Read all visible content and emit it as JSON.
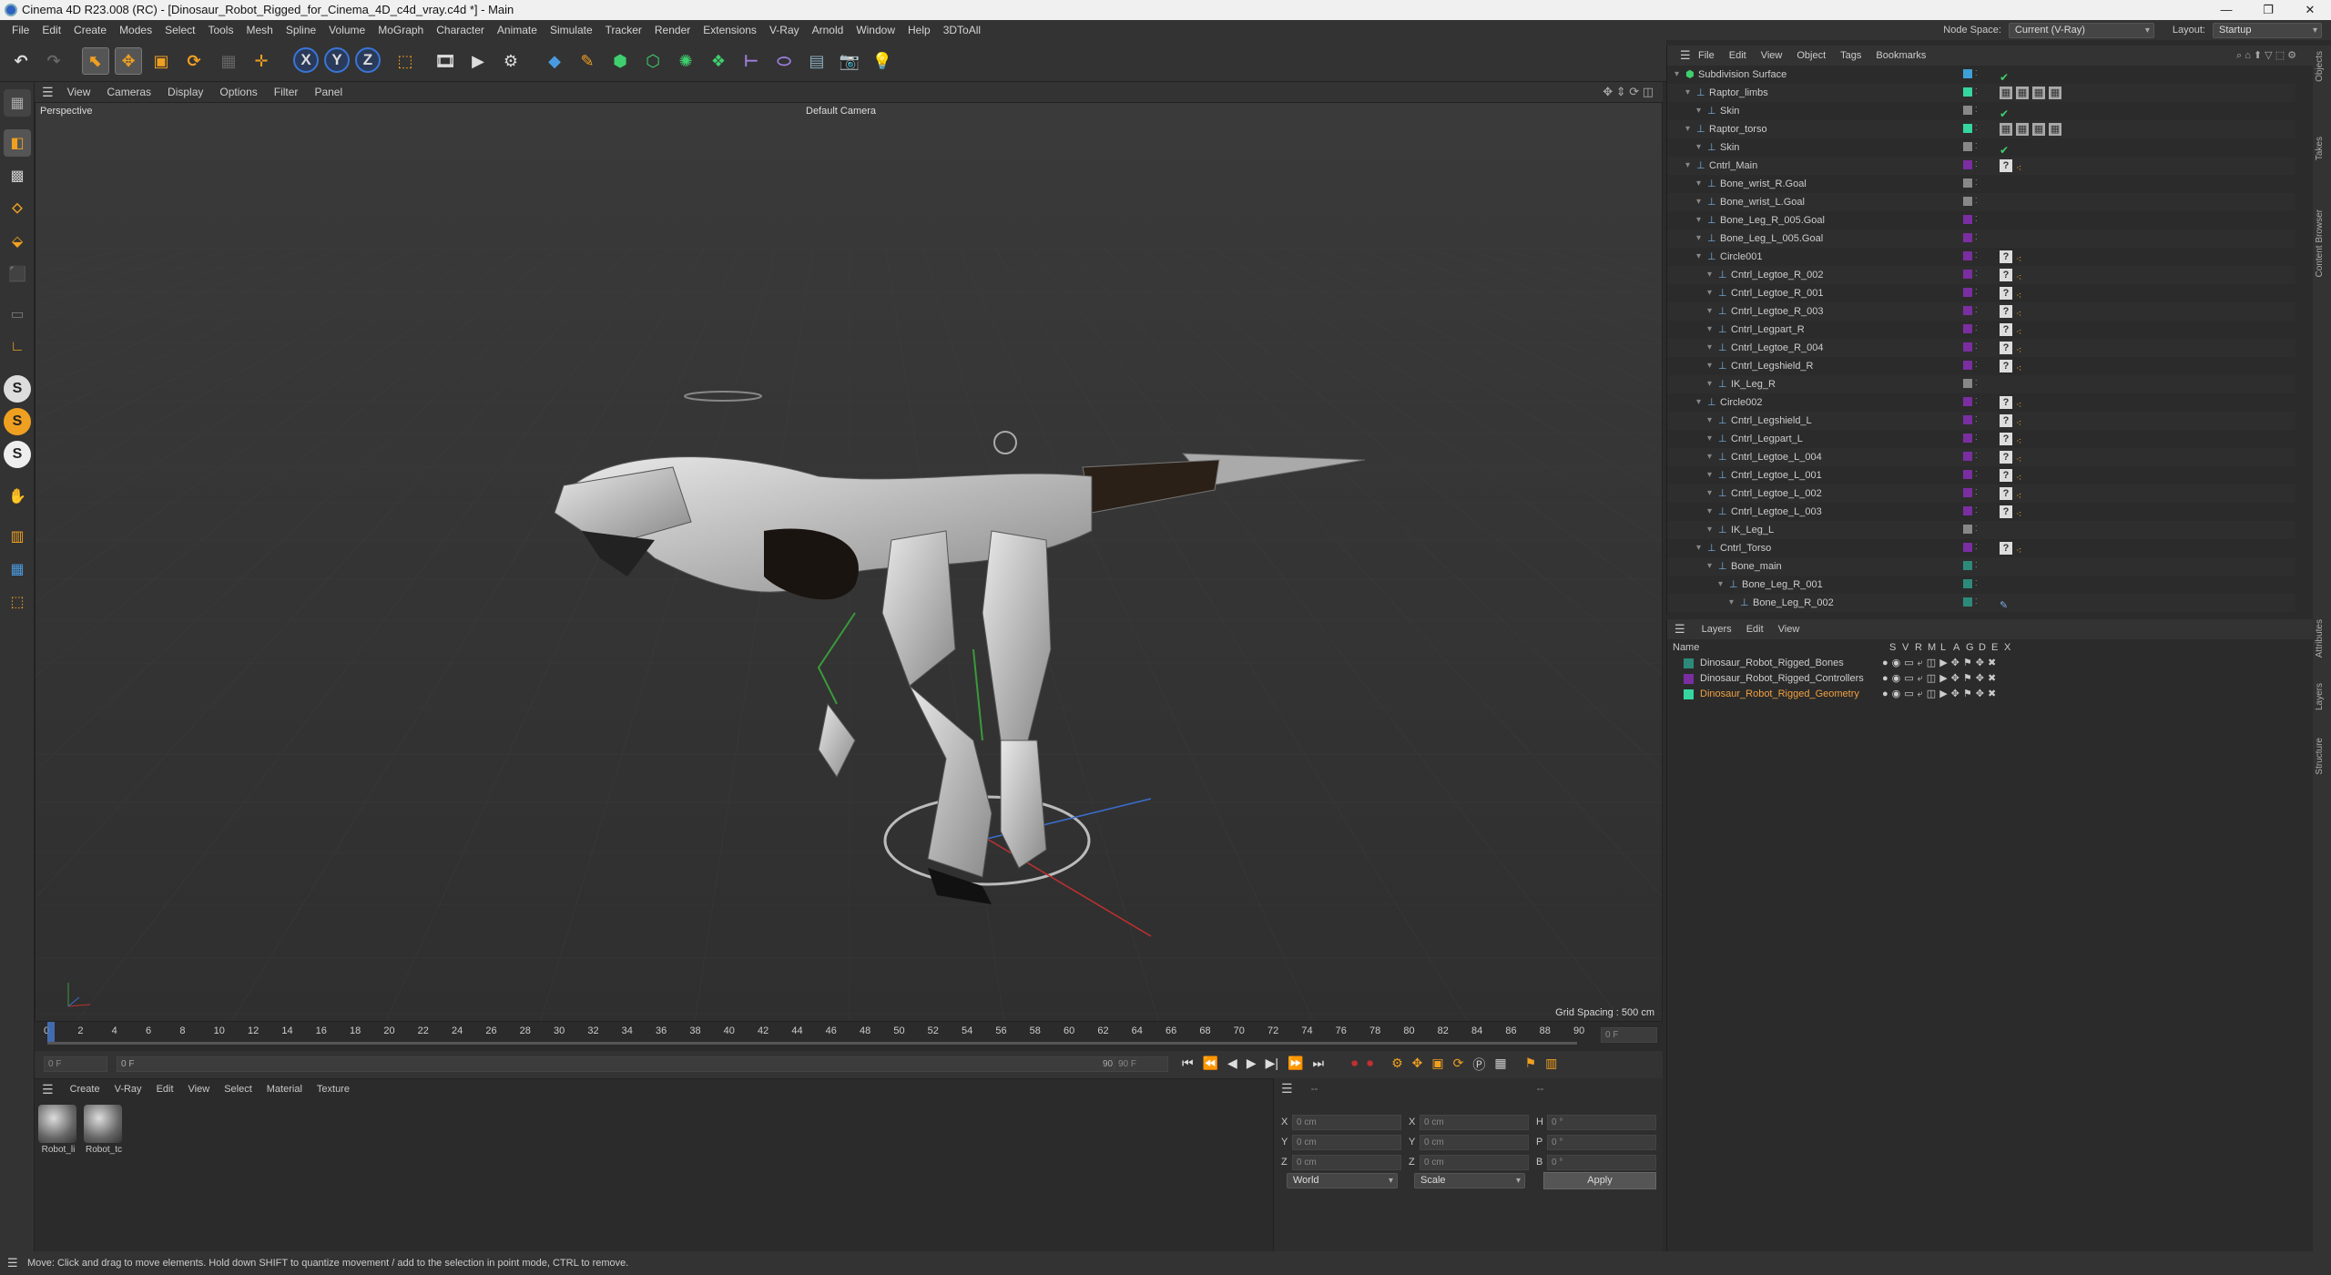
{
  "window": {
    "title": "Cinema 4D R23.008 (RC) - [Dinosaur_Robot_Rigged_for_Cinema_4D_c4d_vray.c4d *] - Main",
    "min": "—",
    "max": "❐",
    "close": "✕"
  },
  "menu": [
    "File",
    "Edit",
    "Create",
    "Modes",
    "Select",
    "Tools",
    "Mesh",
    "Spline",
    "Volume",
    "MoGraph",
    "Character",
    "Animate",
    "Simulate",
    "Tracker",
    "Render",
    "Extensions",
    "V-Ray",
    "Arnold",
    "Window",
    "Help",
    "3DToAll"
  ],
  "nodespace": {
    "label": "Node Space:",
    "value": "Current (V-Ray)"
  },
  "layout": {
    "label": "Layout:",
    "value": "Startup"
  },
  "toolbar": {
    "x": "X",
    "y": "Y",
    "z": "Z"
  },
  "viewport": {
    "menus": [
      "View",
      "Cameras",
      "Display",
      "Options",
      "Filter",
      "Panel"
    ],
    "name": "Perspective",
    "camera": "Default Camera",
    "grid": "Grid Spacing : 500 cm"
  },
  "timeline": {
    "ticks": [
      "0",
      "2",
      "4",
      "6",
      "8",
      "10",
      "12",
      "14",
      "16",
      "18",
      "20",
      "22",
      "24",
      "26",
      "28",
      "30",
      "32",
      "34",
      "36",
      "38",
      "40",
      "42",
      "44",
      "46",
      "48",
      "50",
      "52",
      "54",
      "56",
      "58",
      "60",
      "62",
      "64",
      "66",
      "68",
      "70",
      "72",
      "74",
      "76",
      "78",
      "80",
      "82",
      "84",
      "86",
      "88",
      "90"
    ],
    "frame_end": "0 F"
  },
  "playback": {
    "start": "0 F",
    "current": "0 F",
    "end": "90 F",
    "end2": "90 F"
  },
  "materials": {
    "menus": [
      "Create",
      "V-Ray",
      "Edit",
      "View",
      "Select",
      "Material",
      "Texture"
    ],
    "items": [
      "Robot_li",
      "Robot_tc"
    ]
  },
  "coords": {
    "header": "--",
    "sep": "--",
    "rows": [
      {
        "a": "X",
        "av": "0 cm",
        "b": "X",
        "bv": "0 cm",
        "c": "H",
        "cv": "0 °"
      },
      {
        "a": "Y",
        "av": "0 cm",
        "b": "Y",
        "bv": "0 cm",
        "c": "P",
        "cv": "0 °"
      },
      {
        "a": "Z",
        "av": "0 cm",
        "b": "Z",
        "bv": "0 cm",
        "c": "B",
        "cv": "0 °"
      }
    ],
    "mode": "World",
    "scale": "Scale",
    "apply": "Apply"
  },
  "objects": {
    "menus": [
      "File",
      "Edit",
      "View",
      "Object",
      "Tags",
      "Bookmarks"
    ],
    "rows": [
      {
        "n": "Subdivision Surface",
        "d": 0,
        "c": "#3fa0d8",
        "t": "check"
      },
      {
        "n": "Raptor_limbs",
        "d": 1,
        "c": "#35d6a0",
        "t": "mat"
      },
      {
        "n": "Skin",
        "d": 2,
        "c": "#888",
        "t": "check"
      },
      {
        "n": "Raptor_torso",
        "d": 1,
        "c": "#35d6a0",
        "t": "mat"
      },
      {
        "n": "Skin",
        "d": 2,
        "c": "#888",
        "t": "check"
      },
      {
        "n": "Cntrl_Main",
        "d": 1,
        "c": "#7a2ea0",
        "t": "q"
      },
      {
        "n": "Bone_wrist_R.Goal",
        "d": 2,
        "c": "#888",
        "t": ""
      },
      {
        "n": "Bone_wrist_L.Goal",
        "d": 2,
        "c": "#888",
        "t": ""
      },
      {
        "n": "Bone_Leg_R_005.Goal",
        "d": 2,
        "c": "#7a2ea0",
        "t": ""
      },
      {
        "n": "Bone_Leg_L_005.Goal",
        "d": 2,
        "c": "#7a2ea0",
        "t": ""
      },
      {
        "n": "Circle001",
        "d": 2,
        "c": "#7a2ea0",
        "t": "q"
      },
      {
        "n": "Cntrl_Legtoe_R_002",
        "d": 3,
        "c": "#7a2ea0",
        "t": "q"
      },
      {
        "n": "Cntrl_Legtoe_R_001",
        "d": 3,
        "c": "#7a2ea0",
        "t": "q"
      },
      {
        "n": "Cntrl_Legtoe_R_003",
        "d": 3,
        "c": "#7a2ea0",
        "t": "q"
      },
      {
        "n": "Cntrl_Legpart_R",
        "d": 3,
        "c": "#7a2ea0",
        "t": "q"
      },
      {
        "n": "Cntrl_Legtoe_R_004",
        "d": 3,
        "c": "#7a2ea0",
        "t": "q"
      },
      {
        "n": "Cntrl_Legshield_R",
        "d": 3,
        "c": "#7a2ea0",
        "t": "q"
      },
      {
        "n": "IK_Leg_R",
        "d": 3,
        "c": "#888",
        "t": ""
      },
      {
        "n": "Circle002",
        "d": 2,
        "c": "#7a2ea0",
        "t": "q"
      },
      {
        "n": "Cntrl_Legshield_L",
        "d": 3,
        "c": "#7a2ea0",
        "t": "q"
      },
      {
        "n": "Cntrl_Legpart_L",
        "d": 3,
        "c": "#7a2ea0",
        "t": "q"
      },
      {
        "n": "Cntrl_Legtoe_L_004",
        "d": 3,
        "c": "#7a2ea0",
        "t": "q"
      },
      {
        "n": "Cntrl_Legtoe_L_001",
        "d": 3,
        "c": "#7a2ea0",
        "t": "q"
      },
      {
        "n": "Cntrl_Legtoe_L_002",
        "d": 3,
        "c": "#7a2ea0",
        "t": "q"
      },
      {
        "n": "Cntrl_Legtoe_L_003",
        "d": 3,
        "c": "#7a2ea0",
        "t": "q"
      },
      {
        "n": "IK_Leg_L",
        "d": 3,
        "c": "#888",
        "t": ""
      },
      {
        "n": "Cntrl_Torso",
        "d": 2,
        "c": "#7a2ea0",
        "t": "q"
      },
      {
        "n": "Bone_main",
        "d": 3,
        "c": "#2d8a7a",
        "t": ""
      },
      {
        "n": "Bone_Leg_R_001",
        "d": 4,
        "c": "#2d8a7a",
        "t": ""
      },
      {
        "n": "Bone_Leg_R_002",
        "d": 5,
        "c": "#2d8a7a",
        "t": "ik"
      }
    ]
  },
  "layers": {
    "menus": [
      "Layers",
      "Edit",
      "View"
    ],
    "cols": [
      "Name",
      "S",
      "V",
      "R",
      "M",
      "L",
      "A",
      "G",
      "D",
      "E",
      "X"
    ],
    "rows": [
      {
        "n": "Dinosaur_Robot_Rigged_Bones",
        "c": "#2d8a7a",
        "active": false
      },
      {
        "n": "Dinosaur_Robot_Rigged_Controllers",
        "c": "#7a2ea0",
        "active": false
      },
      {
        "n": "Dinosaur_Robot_Rigged_Geometry",
        "c": "#35d6a0",
        "active": true
      }
    ]
  },
  "side_tabs": [
    "Objects",
    "Takes",
    "Content Browser",
    "Attributes",
    "Layers",
    "Structure"
  ],
  "status": "Move: Click and drag to move elements. Hold down SHIFT to quantize movement / add to the selection in point mode, CTRL to remove."
}
